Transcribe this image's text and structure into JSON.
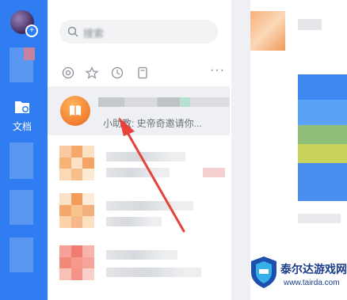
{
  "rail": {
    "docs_label": "文档"
  },
  "search": {
    "placeholder_blurred": "搜索"
  },
  "toolbar": {
    "icons": [
      "at-icon",
      "star-icon",
      "clock-icon",
      "file-icon"
    ],
    "more_label": "···"
  },
  "chats": [
    {
      "type": "bot",
      "preview": "小助教: 史帝奇邀请你..."
    },
    {
      "type": "group"
    },
    {
      "type": "group"
    },
    {
      "type": "group"
    },
    {
      "type": "group"
    }
  ],
  "watermark": {
    "title": "泰尔达游戏网",
    "url": "www.tairda.com"
  },
  "colors": {
    "rail": "#2f7df0",
    "active_item": "#eef0f3",
    "arrow": "#e8403a",
    "bot_avatar": "#f39340"
  }
}
